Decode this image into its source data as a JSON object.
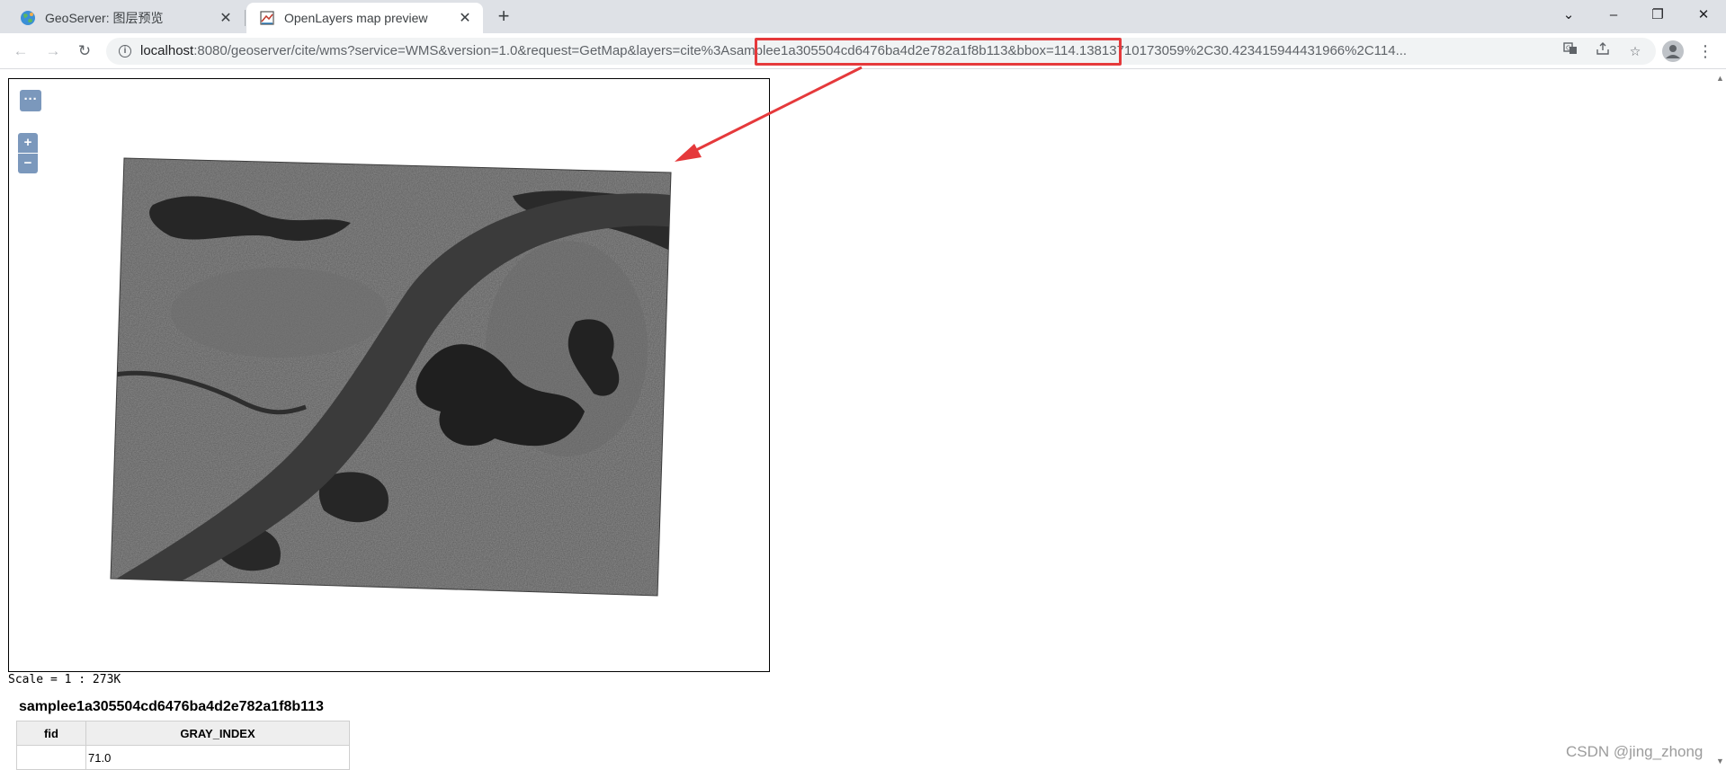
{
  "browser": {
    "tabs": [
      {
        "title": "GeoServer: 图层预览",
        "active": false,
        "favicon": "geoserver-globe-icon"
      },
      {
        "title": "OpenLayers map preview",
        "active": true,
        "favicon": "openlayers-icon"
      }
    ],
    "new_tab_symbol": "+",
    "window_controls": {
      "tab_search": "⌄",
      "minimize": "–",
      "restore": "❐",
      "close": "✕"
    },
    "nav": {
      "back": "←",
      "forward": "→",
      "reload": "↻"
    },
    "url_host": "localhost",
    "url_rest": ":8080/geoserver/cite/wms?service=WMS&version=1.0&request=GetMap&layers=cite%3Asamplee1a305504cd6476ba4d2e782a1f8b113&bbox=114.13813710173059%2C30.423415944431966%2C114...",
    "omnibox_icons": [
      "translate-icon",
      "share-icon",
      "bookmark-star-icon"
    ],
    "menu_symbol": "⋮"
  },
  "annotation": {
    "highlight_color": "#e5393b"
  },
  "map": {
    "toggle_label": "···",
    "zoom_in_label": "+",
    "zoom_out_label": "−",
    "control_color": "#7b98bc",
    "scale_text": "Scale = 1 : 273K"
  },
  "feature_info": {
    "layer_name": "samplee1a305504cd6476ba4d2e782a1f8b113",
    "columns": [
      "fid",
      "GRAY_INDEX"
    ],
    "rows": [
      [
        "",
        "71.0"
      ]
    ]
  },
  "watermark": "CSDN @jing_zhong"
}
